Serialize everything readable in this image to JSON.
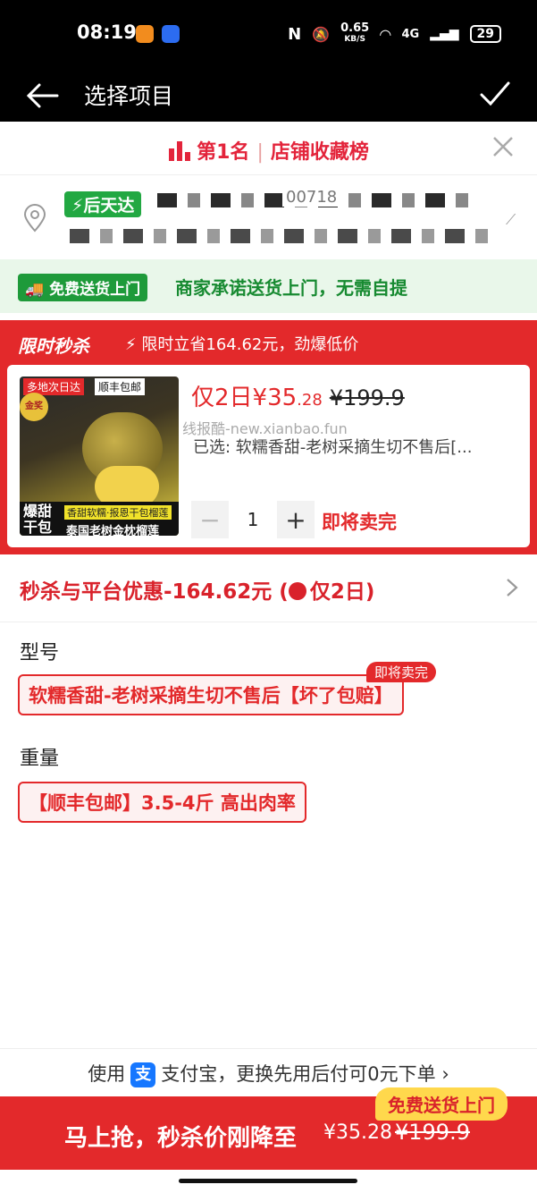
{
  "status_bar": {
    "time": "08:19",
    "speed": "0.65",
    "speed_unit": "KB/S",
    "network": "4G",
    "battery": "29"
  },
  "header": {
    "title": "选择项目",
    "back_icon": "arrow-left-icon",
    "confirm_icon": "check-icon"
  },
  "rank_banner": {
    "rank": "第1名",
    "list_name": "店铺收藏榜",
    "close_icon": "close-icon"
  },
  "address": {
    "badge": "后天达",
    "line1_fragment": "00718"
  },
  "free_delivery": {
    "badge": "免费送货上门",
    "text": "商家承诺送货上门，无需自提"
  },
  "flash_sale": {
    "title": "限时秒杀",
    "subtitle": "限时立省164.62元，劲爆低价",
    "product": {
      "image_tags": {
        "tag1": "多地次日达",
        "tag2": "顺丰包邮",
        "gold": "金奖",
        "bottom_left": "爆甜干包",
        "bottom_tag": "香甜软糯·报恩干包榴莲",
        "bottom_name": "泰国老树金枕榴莲"
      },
      "price_prefix": "仅2日¥35",
      "price_decimal": ".28",
      "original_price": "¥199.9",
      "watermark": "线报酷-new.xianbao.fun",
      "selected": "已选: 软糯香甜-老树采摘生切不售后[...",
      "quantity": "1",
      "stock_status": "即将卖完"
    }
  },
  "discount_row": {
    "text": "秒杀与平台优惠-164.62元 (",
    "clock_icon": "alarm-clock-icon",
    "suffix": "仅2日)"
  },
  "specs": [
    {
      "title": "型号",
      "option": "软糯香甜-老树采摘生切不售后【坏了包赔】",
      "badge": "即将卖完"
    },
    {
      "title": "重量",
      "option": "【顺丰包邮】3.5-4斤 高出肉率"
    }
  ],
  "pay_bar": {
    "prefix": "使用",
    "alipay_glyph": "支",
    "text": "支付宝，更换先用后付可0元下单 ›"
  },
  "buy_bar": {
    "chip": "免费送货上门",
    "label": "马上抢，秒杀价刚降至",
    "price": "¥35.28",
    "original": "¥199.9"
  },
  "colors": {
    "accent_red": "#e3292b",
    "green": "#1e9a3a",
    "chip_yellow": "#ffd84c"
  }
}
